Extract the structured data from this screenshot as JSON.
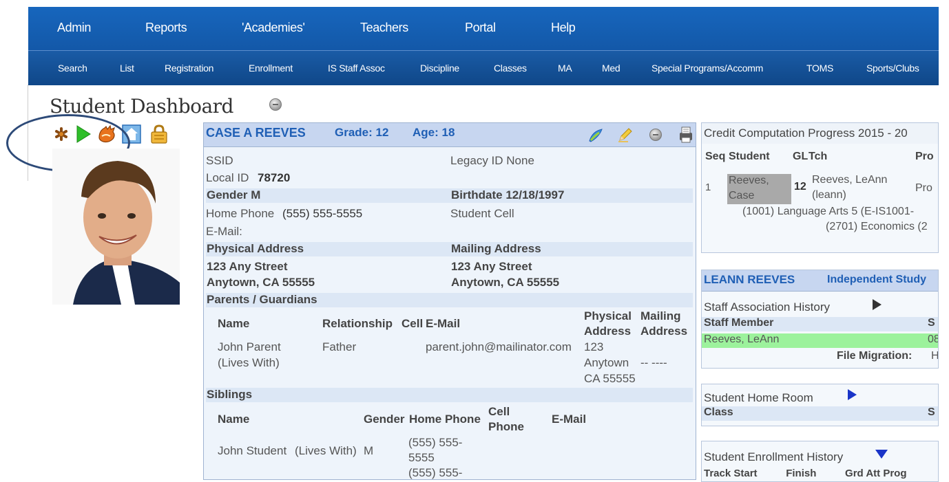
{
  "nav_primary": [
    "Admin",
    "Reports",
    "'Academies'",
    "Teachers",
    "Portal",
    "Help"
  ],
  "nav_secondary": [
    "Search",
    "List",
    "Registration",
    "Enrollment",
    "IS Staff Assoc",
    "Discipline",
    "Classes",
    "MA",
    "Med",
    "Special Programs/Accomm",
    "TOMS",
    "Sports/Clubs"
  ],
  "page": {
    "title": "Student Dashboard"
  },
  "quick_icons": [
    "asterisk-icon",
    "play-icon",
    "hand-icon",
    "home-icon",
    "lock-icon"
  ],
  "student": {
    "name": "CASE A REEVES",
    "grade": "Grade: 12",
    "age": "Age: 18",
    "ssid_label": "SSID",
    "legacy_id": "Legacy ID None",
    "local_id_label": "Local ID",
    "local_id": "78720",
    "gender": "Gender M",
    "birthdate": "Birthdate 12/18/1997",
    "home_phone_label": "Home Phone",
    "home_phone": "(555) 555-5555",
    "student_cell": "Student Cell",
    "email_label": "E-Mail:",
    "physical_address_label": "Physical Address",
    "mailing_address_label": "Mailing Address",
    "physical_line1": "123 Any Street",
    "physical_line2": "Anytown, CA 55555",
    "mailing_line1": "123 Any Street",
    "mailing_line2": "Anytown, CA 55555"
  },
  "guardians": {
    "section_label": "Parents / Guardians",
    "headers": {
      "name": "Name",
      "relationship": "Relationship",
      "cell": "Cell",
      "email": "E-Mail",
      "physical1": "Physical",
      "physical2": "Address",
      "mailing1": "Mailing",
      "mailing2": "Address"
    },
    "row": {
      "name": "John Parent",
      "lives_with": "(Lives With)",
      "relationship": "Father",
      "email": "parent.john@mailinator.com",
      "phys1": "123",
      "phys2": "Anytown",
      "phys3": "CA 55555",
      "mailing": "-- ----"
    }
  },
  "siblings": {
    "section_label": "Siblings",
    "headers": {
      "name": "Name",
      "gender": "Gender",
      "home_phone": "Home Phone",
      "cell1": "Cell",
      "cell2": "Phone",
      "email": "E-Mail"
    },
    "row": {
      "name": "John Student",
      "lives_with": "(Lives With)",
      "gender": "M",
      "phone1": "(555) 555-",
      "phone2": "5555",
      "phone3": "(555) 555-"
    }
  },
  "credit_panel": {
    "title": "Credit Computation Progress 2015 - 20",
    "headers": {
      "seq": "Seq",
      "student": "Student",
      "gl": "GL",
      "tch": "Tch",
      "prog": "Pro"
    },
    "row": {
      "seq": "1",
      "student1": "Reeves,",
      "student2": "Case",
      "gl": "12",
      "tch1": "Reeves, LeAnn",
      "tch2": "(leann)",
      "prog": "Pro"
    },
    "line1": "(1001) Language Arts 5 (E-IS1001-",
    "line2": "(2701) Economics (2"
  },
  "staff_panel": {
    "name": "LEANN REEVES",
    "label": "Independent Study",
    "history_title": "Staff Association History",
    "staff_member_header": "Staff Member",
    "right_header": "S",
    "staff_member": "Reeves, LeAnn",
    "right_value": "08",
    "file_migration": "File Migration:",
    "file_migration_value": "H"
  },
  "homeroom_panel": {
    "title": "Student Home Room",
    "class_header": "Class",
    "right_header": "S"
  },
  "enrollment_panel": {
    "title": "Student Enrollment History",
    "headers": "Track Start          Finish          Grd Att Prog"
  },
  "colors": {
    "nav": "#1766bd",
    "accent": "#1f5fb5",
    "highlight_row": "#9cf29c"
  }
}
